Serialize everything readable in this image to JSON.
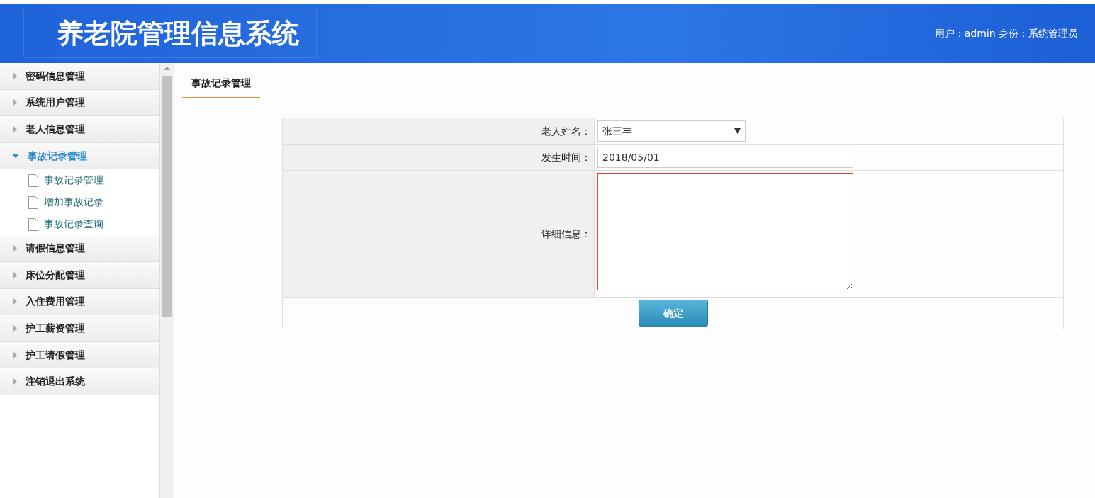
{
  "header": {
    "title": "养老院管理信息系统",
    "user_info": "用户：admin 身份：系统管理员"
  },
  "sidebar": {
    "menus": [
      {
        "label": "密码信息管理",
        "expanded": false
      },
      {
        "label": "系统用户管理",
        "expanded": false
      },
      {
        "label": "老人信息管理",
        "expanded": false
      },
      {
        "label": "事故记录管理",
        "expanded": true,
        "children": [
          {
            "label": "事故记录管理"
          },
          {
            "label": "增加事故记录"
          },
          {
            "label": "事故记录查询"
          }
        ]
      },
      {
        "label": "请假信息管理",
        "expanded": false
      },
      {
        "label": "床位分配管理",
        "expanded": false
      },
      {
        "label": "入住费用管理",
        "expanded": false
      },
      {
        "label": "护工薪资管理",
        "expanded": false
      },
      {
        "label": "护工请假管理",
        "expanded": false
      },
      {
        "label": "注销退出系统",
        "expanded": false
      }
    ]
  },
  "tabs": [
    {
      "label": "事故记录管理",
      "selected": true
    }
  ],
  "form": {
    "fields": [
      {
        "kind": "select",
        "label": "老人姓名：",
        "value": "张三丰"
      },
      {
        "kind": "text",
        "label": "发生时间：",
        "value": "2018/05/01"
      },
      {
        "kind": "textarea",
        "label": "详细信息：",
        "focused": true
      }
    ],
    "submit": "确定"
  }
}
